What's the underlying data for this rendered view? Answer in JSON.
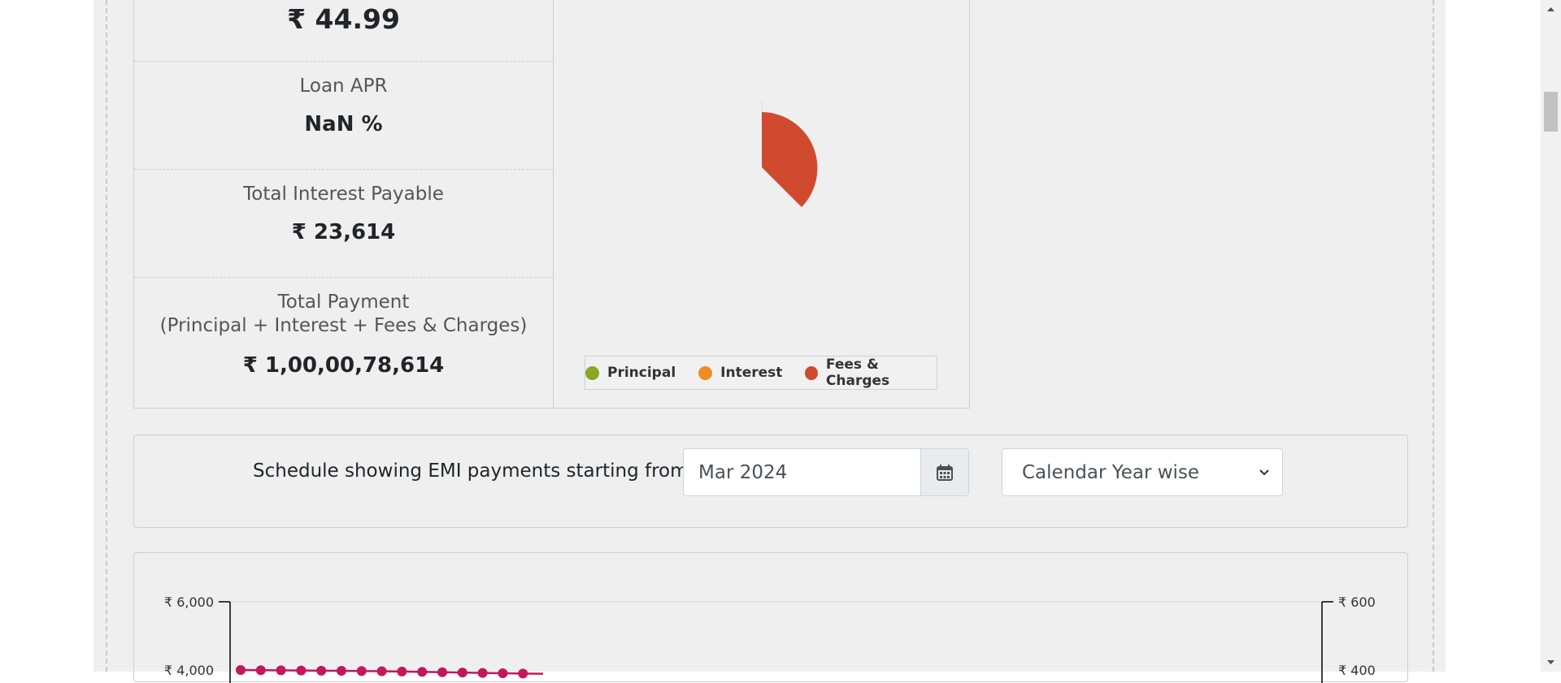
{
  "summary": {
    "top_value": "₹ 44.99",
    "apr_label": "Loan APR",
    "apr_value": "NaN %",
    "interest_label": "Total Interest Payable",
    "interest_value": "₹ 23,614",
    "total_label_1": "Total Payment",
    "total_label_2": "(Principal + Interest + Fees & Charges)",
    "total_value": "₹ 1,00,00,78,614"
  },
  "pie": {
    "legend": [
      {
        "label": "Principal",
        "color": "#8aa626"
      },
      {
        "label": "Interest",
        "color": "#ef8d25"
      },
      {
        "label": "Fees & Charges",
        "color": "#d04a30"
      }
    ]
  },
  "schedule": {
    "label": "Schedule showing EMI payments starting from",
    "date_value": "Mar 2024",
    "view_option": "Calendar Year wise"
  },
  "chart_data": {
    "type": "line",
    "y_left_ticks": [
      "₹ 6,000",
      "₹ 4,000"
    ],
    "y_right_ticks": [
      "₹ 600",
      "₹ 400"
    ],
    "series": [
      {
        "color": "#c2185b",
        "values": [
          4000,
          3995,
          3990,
          3985,
          3980,
          3975,
          3970,
          3965,
          3955,
          3945,
          3935,
          3925,
          3915,
          3905,
          3895,
          3890
        ]
      }
    ]
  }
}
